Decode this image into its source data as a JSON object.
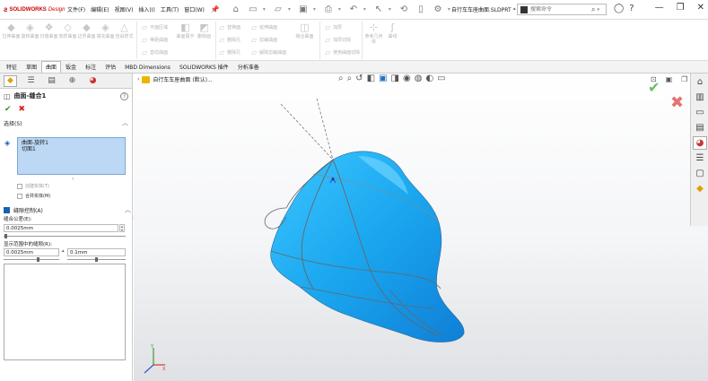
{
  "app": {
    "logo_text": "SOLIDWORKS",
    "logo_sub": "Design",
    "menus": [
      "文件(F)",
      "编辑(E)",
      "视图(V)",
      "插入(I)",
      "工具(T)",
      "窗口(W)"
    ],
    "document_title": "自行车车座曲面.SLDPRT *",
    "search_placeholder": "搜索命令"
  },
  "ribbon": {
    "col1": [
      {
        "label": "拉伸曲面"
      },
      {
        "label": "旋转曲面"
      },
      {
        "label": "扫描曲面"
      },
      {
        "label": "放样曲面"
      },
      {
        "label": "边界曲面"
      },
      {
        "label": "填充曲面"
      },
      {
        "label": "自由样式"
      }
    ],
    "col2": [
      {
        "label": "平面区域"
      },
      {
        "label": "等距曲面"
      },
      {
        "label": "直纹曲面"
      }
    ],
    "col3": [
      {
        "label": "曲面展平"
      },
      {
        "label": "删除面"
      }
    ],
    "col4": [
      {
        "label": "替换面"
      },
      {
        "label": "删除孔"
      },
      {
        "label": "删除孔"
      }
    ],
    "col5": [
      {
        "label": "延伸曲面"
      },
      {
        "label": "剪裁曲面"
      },
      {
        "label": "解除剪裁曲面"
      }
    ],
    "col6": [
      {
        "label": "缝合曲面"
      }
    ],
    "col7": [
      {
        "label": "加厚"
      },
      {
        "label": "加厚切除"
      },
      {
        "label": "使用曲面切除"
      }
    ],
    "col8": [
      {
        "label": "参考几何体"
      },
      {
        "label": "曲线"
      }
    ]
  },
  "tabs": [
    {
      "label": "特征",
      "active": false
    },
    {
      "label": "草图",
      "active": false
    },
    {
      "label": "曲面",
      "active": true
    },
    {
      "label": "钣金",
      "active": false
    },
    {
      "label": "标注",
      "active": false
    },
    {
      "label": "评估",
      "active": false
    },
    {
      "label": "MBD Dimensions",
      "active": false
    },
    {
      "label": "SOLIDWORKS 插件",
      "active": false
    },
    {
      "label": "分析准备",
      "active": false
    }
  ],
  "property_manager": {
    "title": "曲面-缝合1",
    "selection_header": "选择(S)",
    "selection_items": [
      "曲面-旋转1",
      "切面1"
    ],
    "option_create_solid": "创建实体(T)",
    "option_merge": "合并实体(M)",
    "advanced_header": "缝隙控制(A)",
    "tolerance_label": "缝合公差(E):",
    "tolerance_value": "0.0025mm",
    "range_label": "显示范围中的缝隙(R):",
    "range_min": "0.0025mm",
    "range_max": "0.1mm"
  },
  "viewport": {
    "breadcrumb": "自行车车座曲面 (默认)..."
  },
  "colors": {
    "accent": "#1a5fb4",
    "model_blue": "#29b3f0",
    "selection_bg": "#bcd8f4",
    "ok_green": "#2a9d2a",
    "cancel_red": "#d22222"
  }
}
